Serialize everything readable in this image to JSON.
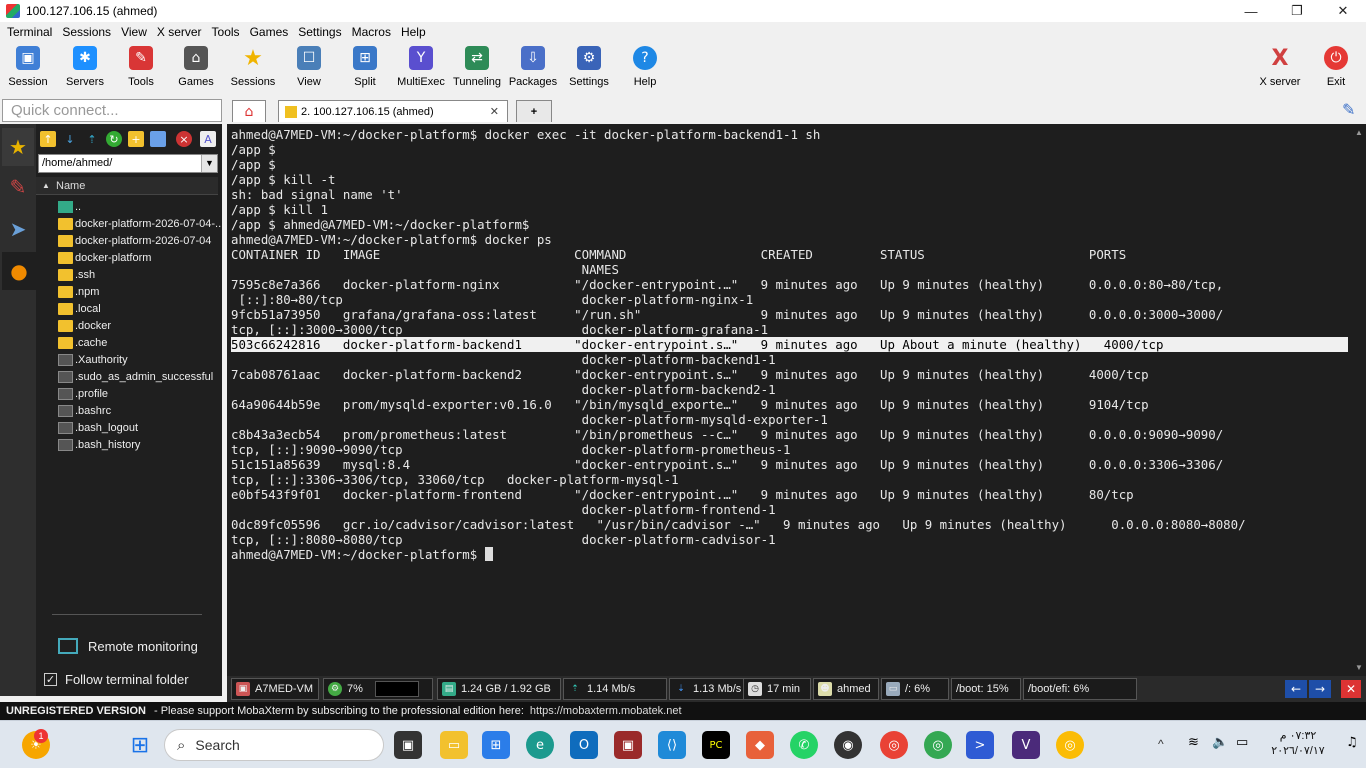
{
  "window": {
    "title": "100.127.106.15 (ahmed)",
    "controls": [
      "—",
      "❐",
      "✕"
    ]
  },
  "menu": [
    "Terminal",
    "Sessions",
    "View",
    "X server",
    "Tools",
    "Games",
    "Settings",
    "Macros",
    "Help"
  ],
  "toolbar": {
    "items": [
      {
        "label": "Session",
        "icon": "session-icon",
        "color": "#3f7fd6"
      },
      {
        "label": "Servers",
        "icon": "servers-icon",
        "color": "#1e90ff"
      },
      {
        "label": "Tools",
        "icon": "tools-icon",
        "color": "#d93636"
      },
      {
        "label": "Games",
        "icon": "games-icon",
        "color": "#555555"
      },
      {
        "label": "Sessions",
        "icon": "star-icon",
        "color": "#f0b400"
      },
      {
        "label": "View",
        "icon": "view-icon",
        "color": "#4a7fb8"
      },
      {
        "label": "Split",
        "icon": "split-icon",
        "color": "#3a78c8"
      },
      {
        "label": "MultiExec",
        "icon": "multiexec-icon",
        "color": "#5a4fcf"
      },
      {
        "label": "Tunneling",
        "icon": "tunneling-icon",
        "color": "#2e8b57"
      },
      {
        "label": "Packages",
        "icon": "packages-icon",
        "color": "#4a6fc8"
      },
      {
        "label": "Settings",
        "icon": "settings-gear-icon",
        "color": "#3a64b8"
      },
      {
        "label": "Help",
        "icon": "help-icon",
        "color": "#1e88e5"
      }
    ],
    "right": [
      {
        "label": "X server",
        "icon": "xserver-icon",
        "color": "#d04040"
      },
      {
        "label": "Exit",
        "icon": "exit-power-icon",
        "color": "#e53935"
      }
    ]
  },
  "quick_connect": {
    "placeholder": "Quick connect..."
  },
  "tabs": {
    "home_icon": "home-icon",
    "active": "2. 100.127.106.15 (ahmed)",
    "close": "✕",
    "new": "+",
    "attach_icon": "paperclip-icon"
  },
  "side_tabs": [
    "star-icon",
    "tools-icon",
    "send-icon",
    "sftp-icon"
  ],
  "file_panel": {
    "path": "/home/ahmed/",
    "column": "Name",
    "items": [
      {
        "name": "..",
        "type": "up"
      },
      {
        "name": "docker-platform-2026-07-04-...",
        "type": "folder"
      },
      {
        "name": "docker-platform-2026-07-04",
        "type": "folder"
      },
      {
        "name": "docker-platform",
        "type": "folder"
      },
      {
        "name": ".ssh",
        "type": "folder"
      },
      {
        "name": ".npm",
        "type": "folder"
      },
      {
        "name": ".local",
        "type": "folder"
      },
      {
        "name": ".docker",
        "type": "folder"
      },
      {
        "name": ".cache",
        "type": "folder"
      },
      {
        "name": ".Xauthority",
        "type": "file"
      },
      {
        "name": ".sudo_as_admin_successful",
        "type": "file"
      },
      {
        "name": ".profile",
        "type": "file"
      },
      {
        "name": ".bashrc",
        "type": "file"
      },
      {
        "name": ".bash_logout",
        "type": "file"
      },
      {
        "name": ".bash_history",
        "type": "file"
      }
    ],
    "remote_monitoring": "Remote monitoring",
    "follow_folder": "Follow terminal folder",
    "follow_checked": true
  },
  "terminal": {
    "lines": [
      "ahmed@A7MED-VM:~/docker-platform$ docker exec -it docker-platform-backend1-1 sh",
      "/app $",
      "/app $",
      "/app $ kill -t",
      "sh: bad signal name 't'",
      "/app $ kill 1",
      "/app $ ahmed@A7MED-VM:~/docker-platform$",
      "ahmed@A7MED-VM:~/docker-platform$ docker ps",
      "CONTAINER ID   IMAGE                          COMMAND                  CREATED         STATUS                      PORTS",
      "                                               NAMES",
      "7595c8e7a366   docker-platform-nginx          \"/docker-entrypoint.…\"   9 minutes ago   Up 9 minutes (healthy)      0.0.0.0:80→80/tcp,",
      " [::]:80→80/tcp                                docker-platform-nginx-1",
      "9fcb51a73950   grafana/grafana-oss:latest     \"/run.sh\"                9 minutes ago   Up 9 minutes (healthy)      0.0.0.0:3000→3000/",
      "tcp, [::]:3000→3000/tcp                        docker-platform-grafana-1",
      "503c66242816   docker-platform-backend1       \"docker-entrypoint.s…\"   9 minutes ago   Up About a minute (healthy)   4000/tcp",
      "                                               docker-platform-backend1-1",
      "7cab08761aac   docker-platform-backend2       \"docker-entrypoint.s…\"   9 minutes ago   Up 9 minutes (healthy)      4000/tcp",
      "                                               docker-platform-backend2-1",
      "64a90644b59e   prom/mysqld-exporter:v0.16.0   \"/bin/mysqld_exporte…\"   9 minutes ago   Up 9 minutes (healthy)      9104/tcp",
      "                                               docker-platform-mysqld-exporter-1",
      "c8b43a3ecb54   prom/prometheus:latest         \"/bin/prometheus --c…\"   9 minutes ago   Up 9 minutes (healthy)      0.0.0.0:9090→9090/",
      "tcp, [::]:9090→9090/tcp                        docker-platform-prometheus-1",
      "51c151a85639   mysql:8.4                      \"docker-entrypoint.s…\"   9 minutes ago   Up 9 minutes (healthy)      0.0.0.0:3306→3306/",
      "tcp, [::]:3306→3306/tcp, 33060/tcp   docker-platform-mysql-1",
      "e0bf543f9f01   docker-platform-frontend       \"/docker-entrypoint.…\"   9 minutes ago   Up 9 minutes (healthy)      80/tcp",
      "                                               docker-platform-frontend-1",
      "0dc89fc05596   gcr.io/cadvisor/cadvisor:latest   \"/usr/bin/cadvisor -…\"   9 minutes ago   Up 9 minutes (healthy)      0.0.0.0:8080→8080/",
      "tcp, [::]:8080→8080/tcp                        docker-platform-cadvisor-1",
      "ahmed@A7MED-VM:~/docker-platform$ "
    ],
    "highlight_line": 14
  },
  "status": {
    "host": "A7MED-VM",
    "cpu": "7%",
    "memory": "1.24 GB / 1.92 GB",
    "upload": "1.14 Mb/s",
    "download": "1.13 Mb/s",
    "uptime": "17 min",
    "user": "ahmed",
    "disk_root": "/: 6%",
    "disk_boot": "/boot: 15%",
    "disk_efi": "/boot/efi: 6%"
  },
  "banner": {
    "bold": "UNREGISTERED VERSION",
    "text": "-  Please support MobaXterm by subscribing to the professional edition here:",
    "url": "https://mobaxterm.mobatek.net"
  },
  "taskbar": {
    "search": "Search",
    "time": "٠٧:٣٢ م",
    "date": "٢٠٢٦/٠٧/١٧",
    "notification_badge": "1"
  }
}
